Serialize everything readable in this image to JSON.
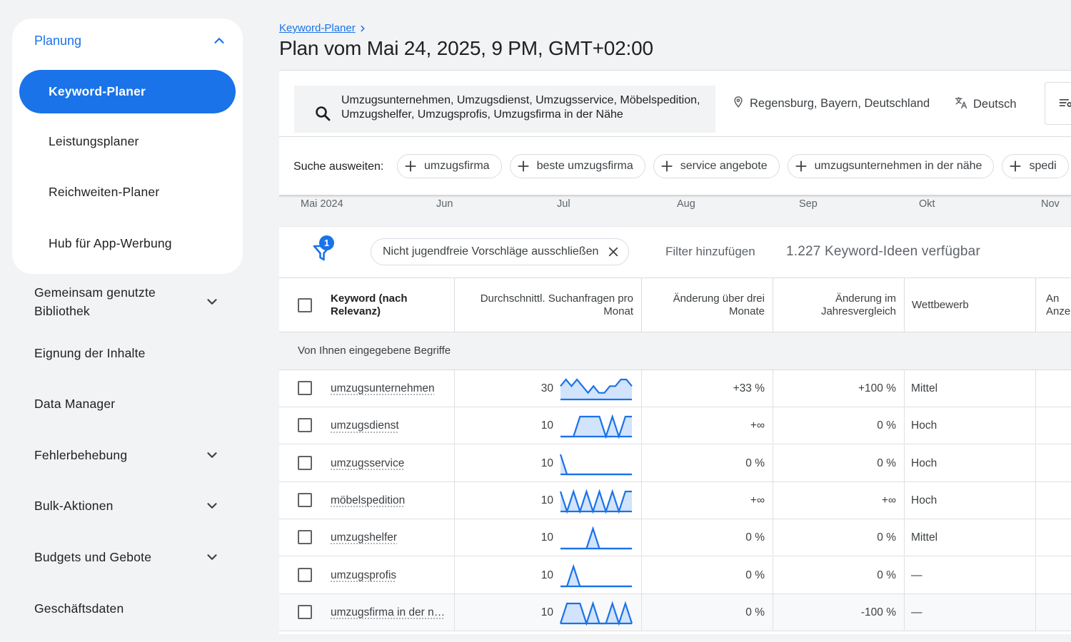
{
  "sidebar": {
    "planning": {
      "title": "Planung",
      "items": [
        {
          "label": "Keyword-Planer",
          "active": true
        },
        {
          "label": "Leistungsplaner"
        },
        {
          "label": "Reichweiten-Planer"
        },
        {
          "label": "Hub für App-Werbung"
        }
      ]
    },
    "sections": [
      {
        "label": "Gemeinsam genutzte Bibliothek",
        "expandable": true
      },
      {
        "label": "Eignung der Inhalte",
        "expandable": false
      },
      {
        "label": "Data Manager",
        "expandable": false
      },
      {
        "label": "Fehlerbehebung",
        "expandable": true
      },
      {
        "label": "Bulk-Aktionen",
        "expandable": true
      },
      {
        "label": "Budgets und Gebote",
        "expandable": true
      },
      {
        "label": "Geschäftsdaten",
        "expandable": false
      }
    ]
  },
  "header": {
    "breadcrumb": "Keyword-Planer",
    "title": "Plan vom Mai 24, 2025, 9 PM, GMT+02:00"
  },
  "search": {
    "keywords": "Umzugsunternehmen, Umzugsdienst, Umzugsservice, Möbelspedition, Umzugshelfer, Umzugsprofis, Umzugsfirma in der Nähe",
    "location": "Regensburg, Bayern, Deutschland",
    "language": "Deutsch",
    "expand_label": "Suche ausweiten:",
    "chips": [
      "umzugsfirma",
      "beste umzugsfirma",
      "service angebote",
      "umzugsunternehmen in der nähe",
      "spedi"
    ]
  },
  "months": [
    "Mai 2024",
    "Jun",
    "Jul",
    "Aug",
    "Sep",
    "Okt",
    "Nov"
  ],
  "filters": {
    "badge_count": "1",
    "active_filter": "Nicht jugendfreie Vorschläge ausschließen",
    "add_filter": "Filter hinzufügen",
    "ideas_count": "1.227 Keyword-Ideen verfügbar"
  },
  "table": {
    "headers": {
      "keyword": "Keyword (nach Relevanz)",
      "avg_searches": "Durchschnittl. Suchanfragen pro Monat",
      "three_month": "Änderung über drei Monate",
      "yoy": "Änderung im Jahresvergleich",
      "competition": "Wettbewerb",
      "ad_share": "An Anze"
    },
    "group_label": "Von Ihnen eingegebene Begriffe",
    "rows": [
      {
        "keyword": "umzugsunternehmen",
        "volume": "30",
        "three_month": "+33 %",
        "yoy": "+100 %",
        "competition": "Mittel",
        "trend": [
          2,
          3,
          2,
          3,
          2,
          1,
          2,
          1,
          1,
          2,
          2,
          3,
          3,
          2
        ]
      },
      {
        "keyword": "umzugsdienst",
        "volume": "10",
        "three_month": "+∞",
        "yoy": "0 %",
        "competition": "Hoch",
        "trend": [
          0,
          0,
          0,
          1,
          1,
          1,
          1,
          0,
          1,
          0,
          1,
          1
        ]
      },
      {
        "keyword": "umzugsservice",
        "volume": "10",
        "three_month": "0 %",
        "yoy": "0 %",
        "competition": "Hoch",
        "trend": [
          1,
          0,
          0,
          0,
          0,
          0,
          0,
          0,
          0,
          0,
          0,
          0
        ]
      },
      {
        "keyword": "möbelspedition",
        "volume": "10",
        "three_month": "+∞",
        "yoy": "+∞",
        "competition": "Hoch",
        "trend": [
          1,
          0,
          1,
          0,
          1,
          0,
          1,
          0,
          1,
          0,
          1,
          1
        ]
      },
      {
        "keyword": "umzugshelfer",
        "volume": "10",
        "three_month": "0 %",
        "yoy": "0 %",
        "competition": "Mittel",
        "trend": [
          0,
          0,
          0,
          0,
          0,
          1,
          0,
          0,
          0,
          0,
          0,
          0
        ]
      },
      {
        "keyword": "umzugsprofis",
        "volume": "10",
        "three_month": "0 %",
        "yoy": "0 %",
        "competition": "—",
        "trend": [
          0,
          0,
          1,
          0,
          0,
          0,
          0,
          0,
          0,
          0,
          0,
          0
        ]
      },
      {
        "keyword": "umzugsfirma in der n…",
        "volume": "10",
        "three_month": "0 %",
        "yoy": "-100 %",
        "competition": "—",
        "trend": [
          0,
          1,
          1,
          1,
          0,
          1,
          0,
          0,
          1,
          0,
          1,
          0
        ]
      }
    ]
  },
  "colors": {
    "accent": "#1a73e8",
    "spark_fill": "#d2e3fc"
  }
}
